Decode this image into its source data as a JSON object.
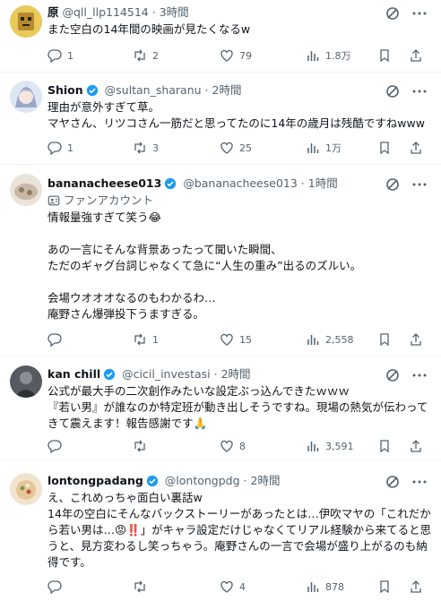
{
  "tweets": [
    {
      "name": "原",
      "handle": "@qll_llp114514",
      "sep": "·",
      "time": "3時間",
      "lines": [
        "また空白の14年間の映画が見たくなるw"
      ],
      "replies": "1",
      "retweets": "2",
      "likes": "79",
      "views": "1.8万"
    },
    {
      "name": "Shion",
      "handle": "@sultan_sharanu",
      "sep": "·",
      "time": "2時間",
      "lines": [
        "理由が意外すぎて草。",
        "マヤさん、リツコさん一筋だと思ってたのに14年の歳月は残酷ですねwww"
      ],
      "replies": "1",
      "retweets": "3",
      "likes": "25",
      "views": "1万"
    },
    {
      "name": "bananacheese013",
      "handle": "@bananacheese013",
      "sep": "·",
      "time": "1時間",
      "badge": "ファンアカウント",
      "lines": [
        "情報量強すぎて笑う😂",
        "",
        "あの一言にそんな背景あったって聞いた瞬間、",
        "ただのギャグ台詞じゃなくて急に“人生の重み”出るのズルい。",
        "",
        "会場ウオオオなるのもわかるわ…",
        "庵野さん爆弾投下うますぎる。"
      ],
      "replies": "",
      "retweets": "1",
      "likes": "15",
      "views": "2,558"
    },
    {
      "name": "kan chill",
      "handle": "@cicil_investasi",
      "sep": "·",
      "time": "2時間",
      "lines": [
        "公式が最大手の二次創作みたいな設定ぶっ込んできたｗｗｗ",
        "『若い男』が誰なのか特定班が動き出しそうですね。現場の熱気が伝わって",
        "きて震えます！報告感謝です🙏"
      ],
      "replies": "",
      "retweets": "",
      "likes": "8",
      "views": "3,591"
    },
    {
      "name": "lontongpadang",
      "handle": "@lontongpdg",
      "sep": "·",
      "time": "2時間",
      "lines": [
        "え、これめっちゃ面白い裏話w",
        "14年の空白にそんなバックストーリーがあったとは…伊吹マヤの「これだか",
        "ら若い男は…😡‼️」がキャラ設定だけじゃなくてリアル経験から来てると思",
        "うと、見方変わるし笑っちゃう。庵野さんの一言で会場が盛り上がるのも納",
        "得です。"
      ],
      "replies": "",
      "retweets": "",
      "likes": "4",
      "views": "878"
    }
  ]
}
